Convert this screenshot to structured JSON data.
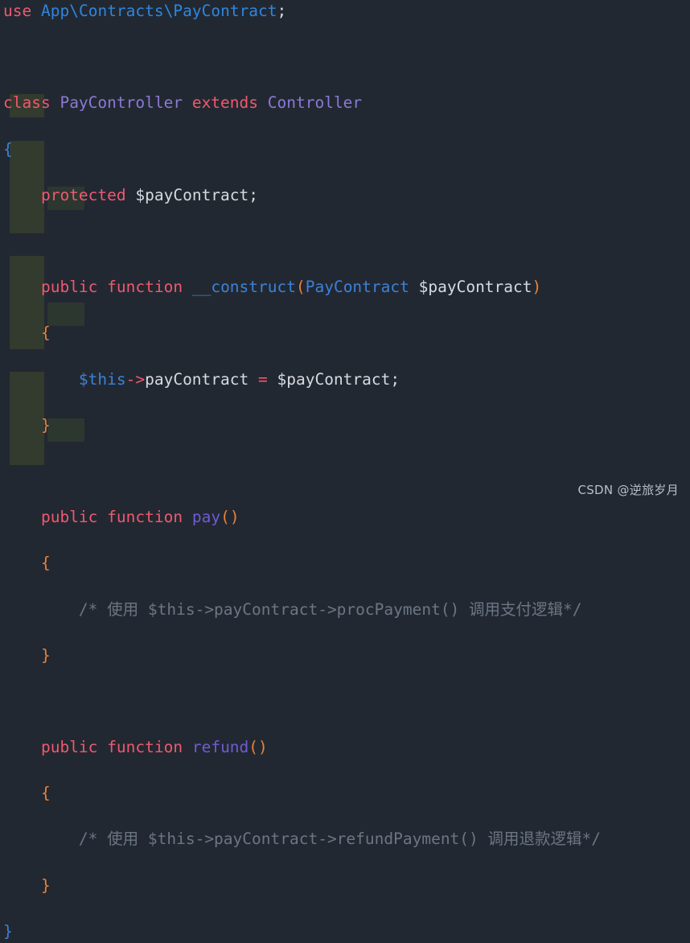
{
  "editor": {
    "language": "php",
    "theme": "one-dark",
    "background_color": "#222831",
    "indent_guide_color_level1": "#333a2e",
    "indent_guide_color_level2": "#2c3730",
    "default_text_color": "#d7dae0"
  },
  "code": {
    "line01": {
      "kw_use": "use",
      "ns_app": "App",
      "sep1": "\\",
      "ns_contracts": "Contracts",
      "sep2": "\\",
      "ns_paycontract": "PayContract",
      "semicolon": ";"
    },
    "line02": {
      "text": ""
    },
    "line03": {
      "kw_class": "class",
      "name_paycontroller": "PayController",
      "kw_extends": "extends",
      "name_controller": "Controller"
    },
    "line04": {
      "brace": "{"
    },
    "line05": {
      "kw_protected": "protected",
      "var_paycontract": "$payContract",
      "semicolon": ";"
    },
    "line06": {
      "text": ""
    },
    "line07": {
      "kw_public": "public",
      "kw_function": "function",
      "fn_construct": "__construct",
      "paren_open": "(",
      "type_paycontract": "PayContract",
      "param_paycontract": "$payContract",
      "paren_close": ")"
    },
    "line08": {
      "brace": "{"
    },
    "line09": {
      "this": "$this",
      "arrow": "->",
      "prop_paycontract": "payContract",
      "assign": "=",
      "var_paycontract": "$payContract",
      "semicolon": ";"
    },
    "line10": {
      "brace": "}"
    },
    "line11": {
      "text": ""
    },
    "line12": {
      "kw_public": "public",
      "kw_function": "function",
      "fn_pay": "pay",
      "parens": "()"
    },
    "line13": {
      "brace": "{"
    },
    "line14": {
      "comment": "/* 使用 $this->payContract->procPayment() 调用支付逻辑*/"
    },
    "line15": {
      "brace": "}"
    },
    "line16": {
      "text": ""
    },
    "line17": {
      "kw_public": "public",
      "kw_function": "function",
      "fn_refund": "refund",
      "parens": "()"
    },
    "line18": {
      "brace": "{"
    },
    "line19": {
      "comment": "/* 使用 $this->payContract->refundPayment() 调用退款逻辑*/"
    },
    "line20": {
      "brace": "}"
    },
    "line21": {
      "brace": "}"
    }
  },
  "watermark": {
    "label": "CSDN @逆旅岁月"
  }
}
